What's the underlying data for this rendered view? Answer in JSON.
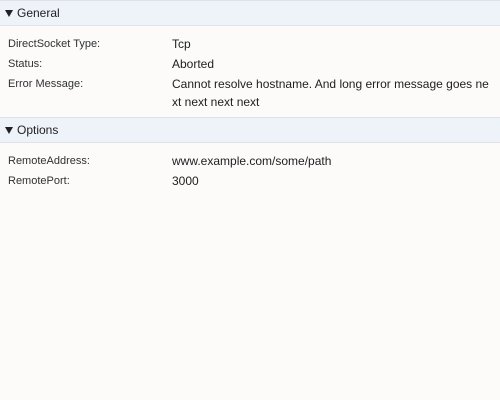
{
  "sections": {
    "general": {
      "title": "General",
      "rows": [
        {
          "label": "DirectSocket Type:",
          "value": "Tcp"
        },
        {
          "label": "Status:",
          "value": "Aborted"
        },
        {
          "label": "Error Message:",
          "value": "Cannot resolve hostname. And long error message goes next next next next"
        }
      ]
    },
    "options": {
      "title": "Options",
      "rows": [
        {
          "label": "RemoteAddress:",
          "value": "www.example.com/some/path"
        },
        {
          "label": "RemotePort:",
          "value": "3000"
        }
      ]
    }
  }
}
